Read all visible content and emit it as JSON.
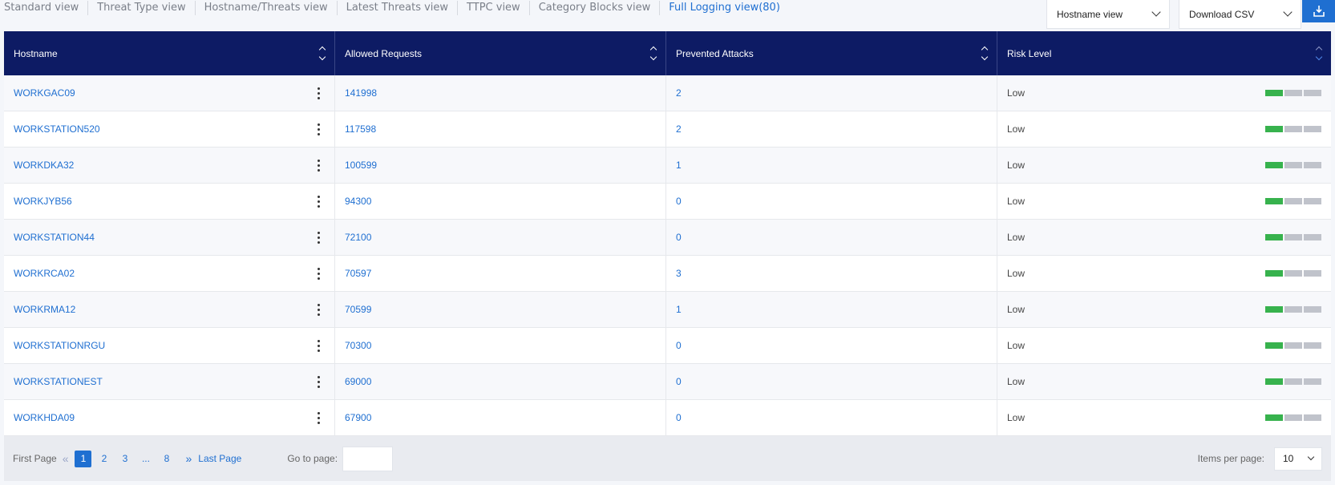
{
  "tabs": [
    {
      "label": "Standard view",
      "active": false
    },
    {
      "label": "Threat Type view",
      "active": false
    },
    {
      "label": "Hostname/Threats view",
      "active": false
    },
    {
      "label": "Latest Threats view",
      "active": false
    },
    {
      "label": "TTPC view",
      "active": false
    },
    {
      "label": "Category Blocks view",
      "active": false
    },
    {
      "label": "Full Logging view(80)",
      "active": true
    }
  ],
  "controls": {
    "view_select": "Hostname view",
    "download_select": "Download CSV",
    "download_icon": "download-icon"
  },
  "table": {
    "columns": [
      "Hostname",
      "Allowed Requests",
      "Prevented Attacks",
      "Risk Level"
    ],
    "rows": [
      {
        "hostname": "WORKGAC09",
        "allowed": "141998",
        "prevented": "2",
        "risk": "Low",
        "risk_level": 1
      },
      {
        "hostname": "WORKSTATION520",
        "allowed": "117598",
        "prevented": "2",
        "risk": "Low",
        "risk_level": 1
      },
      {
        "hostname": "WORKDKA32",
        "allowed": "100599",
        "prevented": "1",
        "risk": "Low",
        "risk_level": 1
      },
      {
        "hostname": "WORKJYB56",
        "allowed": "94300",
        "prevented": "0",
        "risk": "Low",
        "risk_level": 1
      },
      {
        "hostname": "WORKSTATION44",
        "allowed": "72100",
        "prevented": "0",
        "risk": "Low",
        "risk_level": 1
      },
      {
        "hostname": "WORKRCA02",
        "allowed": "70597",
        "prevented": "3",
        "risk": "Low",
        "risk_level": 1
      },
      {
        "hostname": "WORKRMA12",
        "allowed": "70599",
        "prevented": "1",
        "risk": "Low",
        "risk_level": 1
      },
      {
        "hostname": "WORKSTATIONRGU",
        "allowed": "70300",
        "prevented": "0",
        "risk": "Low",
        "risk_level": 1
      },
      {
        "hostname": "WORKSTATIONEST",
        "allowed": "69000",
        "prevented": "0",
        "risk": "Low",
        "risk_level": 1
      },
      {
        "hostname": "WORKHDA09",
        "allowed": "67900",
        "prevented": "0",
        "risk": "Low",
        "risk_level": 1
      }
    ]
  },
  "pagination": {
    "first_label": "First Page",
    "pages": [
      "1",
      "2",
      "3",
      "...",
      "8"
    ],
    "current_page": "1",
    "last_label": "Last Page",
    "goto_label": "Go to page:",
    "goto_value": "",
    "items_per_page_label": "Items per page:",
    "items_per_page": "10"
  },
  "colors": {
    "header_bg": "#0d1b64",
    "accent": "#1f6fd1",
    "risk_on": "#37b24d",
    "risk_off": "#c0c3cb"
  }
}
